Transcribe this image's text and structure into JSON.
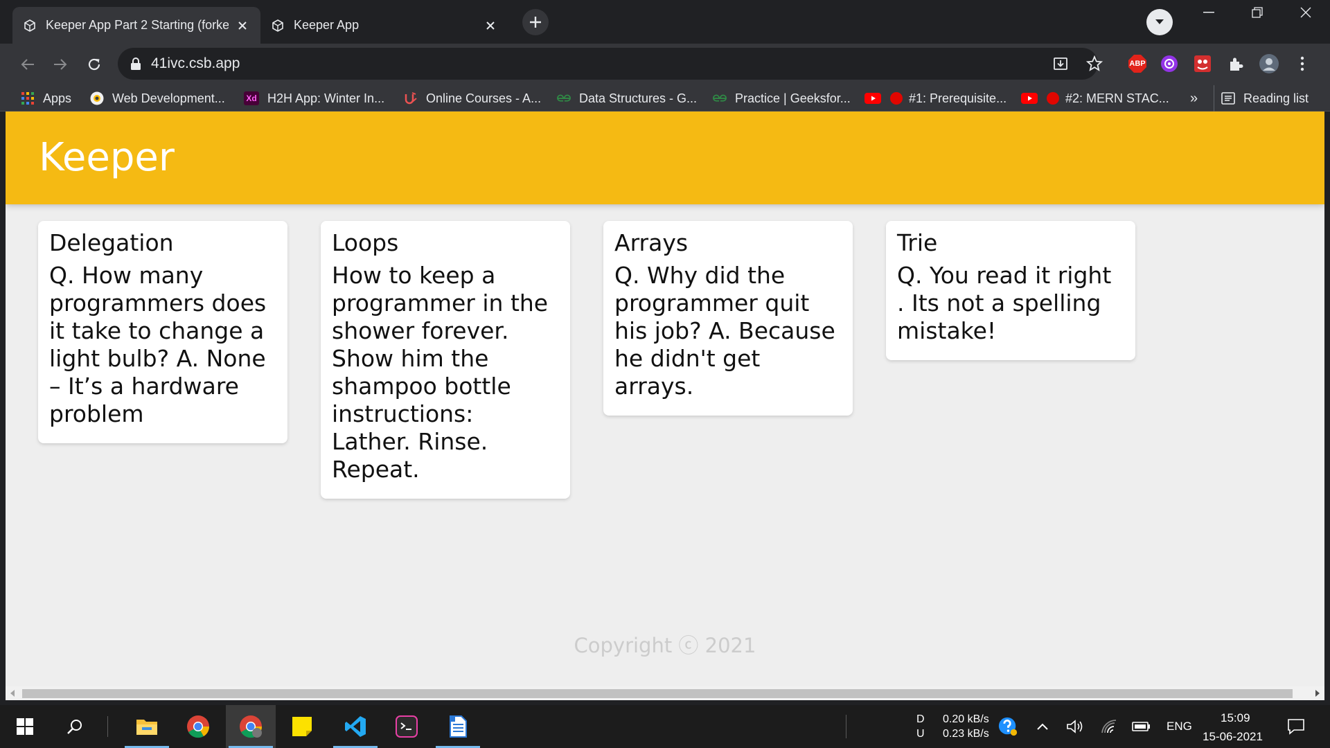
{
  "browser": {
    "tabs": [
      {
        "title": "Keeper App Part 2 Starting (forke",
        "active": true
      },
      {
        "title": "Keeper App",
        "active": false
      }
    ],
    "url": "41ivc.csb.app",
    "extensions": {
      "abp_label": "ABP"
    },
    "bookmarks": [
      {
        "label": "Apps",
        "icon": "apps-grid-icon"
      },
      {
        "label": "Web Development...",
        "icon": "web-dev-icon"
      },
      {
        "label": "H2H App: Winter In...",
        "icon": "xd-icon",
        "badge": "Xd"
      },
      {
        "label": "Online Courses - A...",
        "icon": "udemy-icon"
      },
      {
        "label": "Data Structures - G...",
        "icon": "gfg-icon"
      },
      {
        "label": "Practice | Geeksfor...",
        "icon": "gfg-icon"
      },
      {
        "label": "#1: Prerequisite...",
        "icon": "youtube-icon"
      },
      {
        "label": "#2: MERN STAC...",
        "icon": "youtube-icon"
      }
    ],
    "overflow_label": "»",
    "reading_list_label": "Reading list"
  },
  "app": {
    "title": "Keeper",
    "notes": [
      {
        "title": "Delegation",
        "content": "Q. How many programmers does it take to change a light bulb? A. None – It’s a hardware problem"
      },
      {
        "title": "Loops",
        "content": "How to keep a programmer in the shower forever. Show him the shampoo bottle instructions: Lather. Rinse. Repeat."
      },
      {
        "title": "Arrays",
        "content": "Q. Why did the programmer quit his job? A. Because he didn't get arrays."
      },
      {
        "title": "Trie",
        "content": "Q. You read it right . Its not a spelling mistake!"
      }
    ],
    "footer": "Copyright ⓒ 2021"
  },
  "taskbar": {
    "net_d_label": "D",
    "net_u_label": "U",
    "net_down": "0.20 kB/s",
    "net_up": "0.23 kB/s",
    "language": "ENG",
    "time": "15:09",
    "date": "15-06-2021"
  },
  "colors": {
    "header": "#f5ba13",
    "page_bg": "#eeeeee",
    "card": "#ffffff",
    "footer_text": "#cccccc"
  }
}
